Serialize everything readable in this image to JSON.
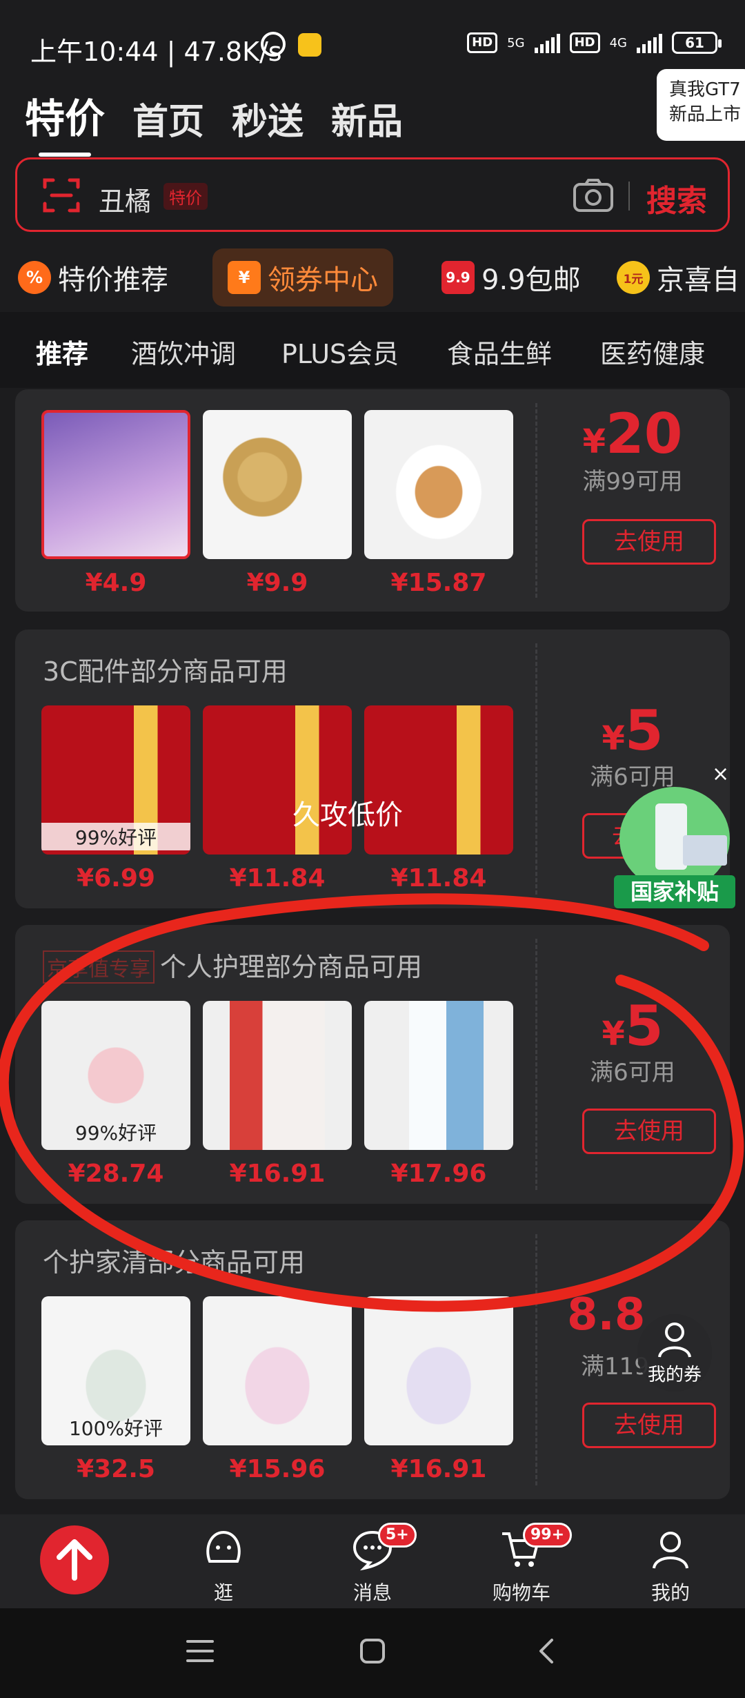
{
  "status_bar": {
    "time": "上午10:44 | 47.8K/s",
    "network_1": "5G",
    "network_2": "4G",
    "hd": "HD",
    "battery": "61"
  },
  "top_tabs": [
    "特价",
    "首页",
    "秒送",
    "新品"
  ],
  "promo_badge": {
    "line1": "真我GT7",
    "line2": "新品上市"
  },
  "search": {
    "text": "丑橘",
    "tag": "特价",
    "button": "搜索"
  },
  "shortcuts": [
    {
      "label": "特价推荐",
      "icon": "percent-icon"
    },
    {
      "label": "领券中心",
      "icon": "yen-coupon-icon"
    },
    {
      "label": "9.9包邮",
      "icon": "nine-nine-icon"
    },
    {
      "label": "京喜自",
      "icon": "one-yuan-icon"
    }
  ],
  "shortcut_icon_text": {
    "percent": "%",
    "yen": "¥",
    "nine": "9.9",
    "one": "1元"
  },
  "subtabs": [
    "推荐",
    "酒饮冲调",
    "PLUS会员",
    "食品生鲜",
    "医药健康"
  ],
  "cards": [
    {
      "title": "",
      "products": [
        {
          "price": "¥4.9",
          "rating": ""
        },
        {
          "price": "¥9.9",
          "rating": ""
        },
        {
          "price": "¥15.87",
          "rating": ""
        }
      ],
      "coupon": {
        "yen": "¥",
        "amount": "20",
        "condition": "满99可用",
        "button": "去使用"
      }
    },
    {
      "title": "3C配件部分商品可用",
      "products": [
        {
          "price": "¥6.99",
          "rating": "99%好评"
        },
        {
          "price": "¥11.84",
          "rating": ""
        },
        {
          "price": "¥11.84",
          "rating": ""
        }
      ],
      "coupon": {
        "yen": "¥",
        "amount": "5",
        "condition": "满6可用",
        "button": "去"
      }
    },
    {
      "plus_tag": "京享值专享",
      "title": "个人护理部分商品可用",
      "products": [
        {
          "price": "¥28.74",
          "rating": "99%好评"
        },
        {
          "price": "¥16.91",
          "rating": ""
        },
        {
          "price": "¥17.96",
          "rating": ""
        }
      ],
      "coupon": {
        "yen": "¥",
        "amount": "5",
        "condition": "满6可用",
        "button": "去使用"
      }
    },
    {
      "title": "个护家清部分商品可用",
      "products": [
        {
          "price": "¥32.5",
          "rating": "100%好评"
        },
        {
          "price": "¥15.96",
          "rating": ""
        },
        {
          "price": "¥16.91",
          "rating": ""
        }
      ],
      "coupon": {
        "yen": "",
        "amount": "8.8",
        "condition": "满119",
        "button": "去使用"
      }
    }
  ],
  "overlay_text": "久攻低价",
  "gov_subsidy": {
    "label": "国家补贴",
    "close": "×"
  },
  "my_coupon": "我的券",
  "bottom_nav": [
    {
      "label": "逛",
      "badge": ""
    },
    {
      "label": "消息",
      "badge": "5+"
    },
    {
      "label": "购物车",
      "badge": "99+"
    },
    {
      "label": "我的",
      "badge": ""
    }
  ],
  "colors": {
    "accent": "#e1252f",
    "background": "#1c1c1e",
    "card": "#2a2a2c"
  }
}
